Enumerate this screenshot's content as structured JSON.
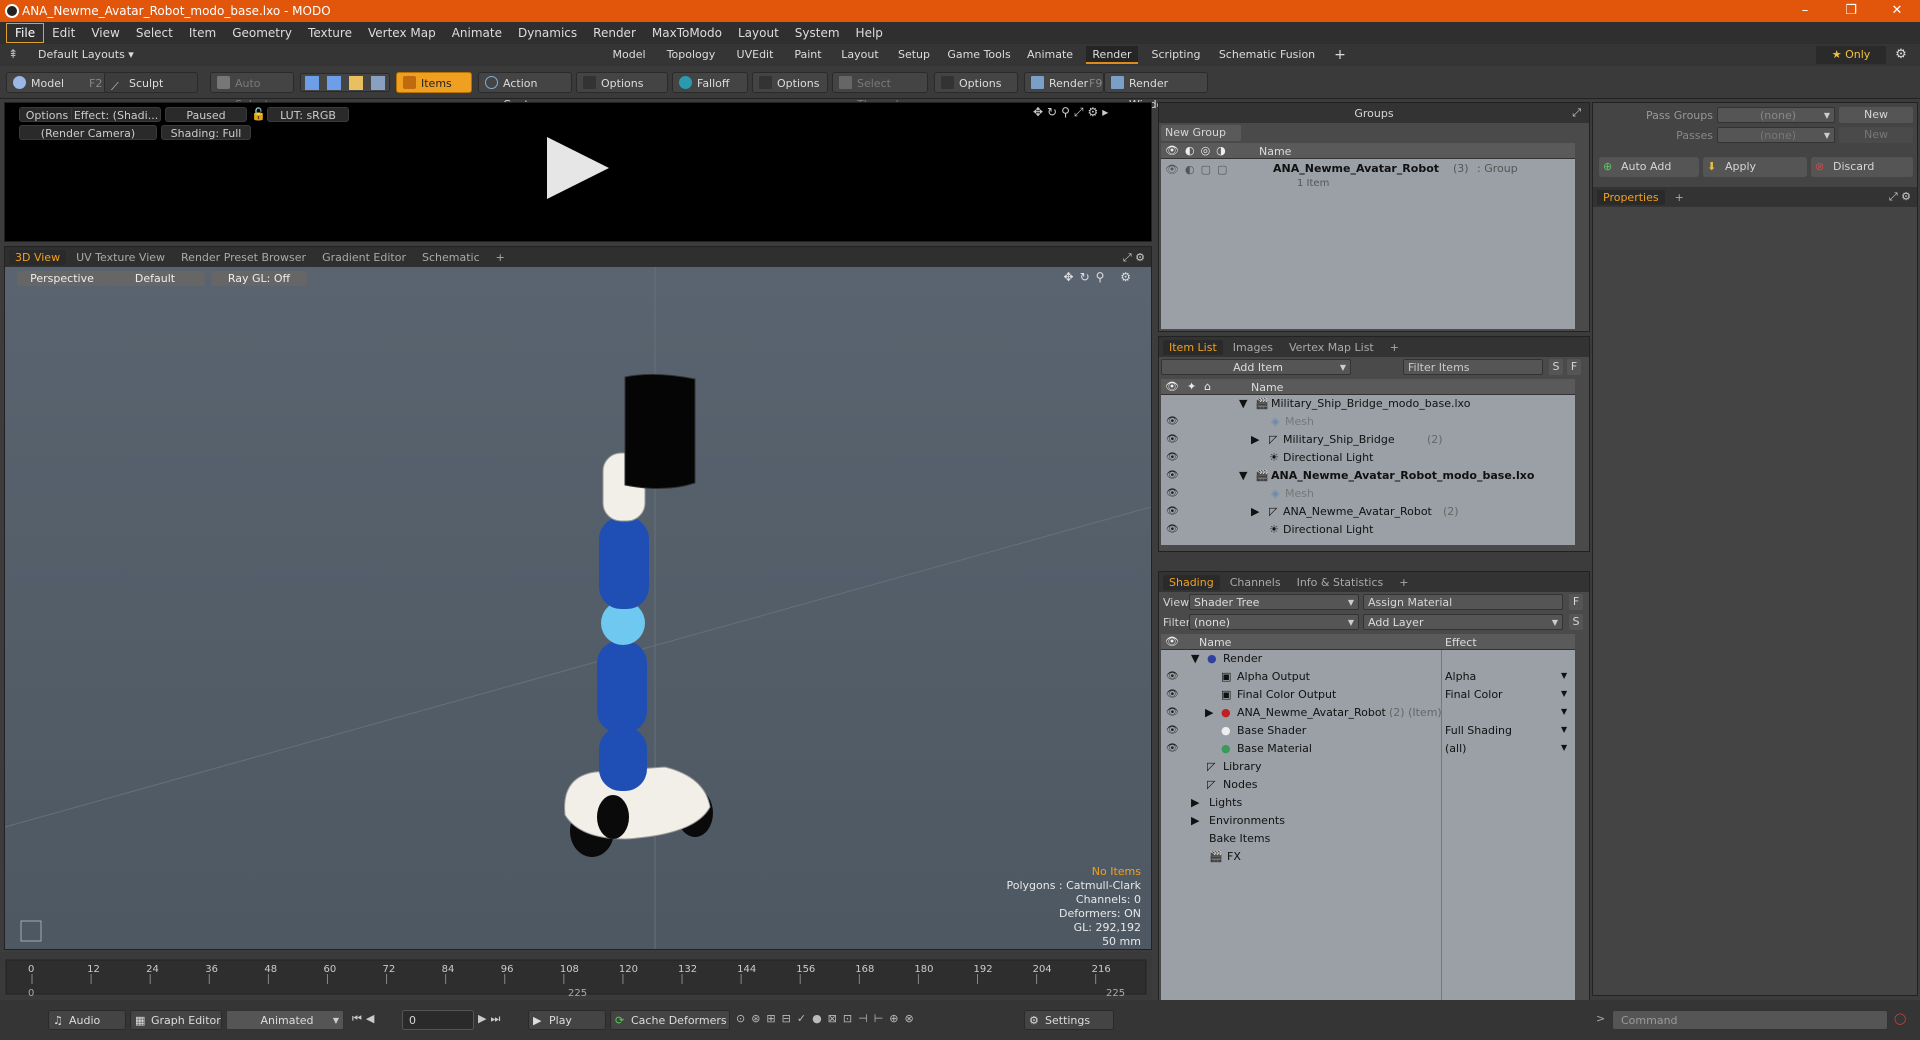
{
  "window": {
    "title": "ANA_Newme_Avatar_Robot_modo_base.lxo - MODO",
    "minimize": "–",
    "maximize": "❐",
    "close": "✕"
  },
  "menu": [
    "File",
    "Edit",
    "View",
    "Select",
    "Item",
    "Geometry",
    "Texture",
    "Vertex Map",
    "Animate",
    "Dynamics",
    "Render",
    "MaxToModo",
    "Layout",
    "System",
    "Help"
  ],
  "layout": {
    "selector": "Default Layouts ▾",
    "tabs": [
      "Model",
      "Topology",
      "UVEdit",
      "Paint",
      "Layout",
      "Setup",
      "Game Tools",
      "Animate",
      "Render",
      "Scripting",
      "Schematic Fusion"
    ],
    "active_tab": "Render",
    "add": "+",
    "only": "★  Only"
  },
  "toolbar": {
    "model": "Model",
    "model_key": "F2",
    "sculpt": "Sculpt",
    "auto_select": "Auto Select",
    "items": "Items",
    "action_center": "Action Center",
    "options1": "Options",
    "falloff": "Falloff",
    "options2": "Options",
    "select_through": "Select Through",
    "options3": "Options",
    "render": "Render",
    "render_key": "F9",
    "render_window": "Render Window"
  },
  "preview": {
    "options": "Options",
    "effect": "Effect: (Shadi...",
    "paused": "Paused",
    "lut": "LUT: sRGB",
    "camera": "(Render Camera)",
    "shading": "Shading: Full"
  },
  "viewport": {
    "tabs": [
      "3D View",
      "UV Texture View",
      "Render Preset Browser",
      "Gradient Editor",
      "Schematic"
    ],
    "add": "+",
    "perspective": "Perspective",
    "default": "Default",
    "raygl": "Ray GL: Off",
    "stats": {
      "no_items": "No Items",
      "polygons": "Polygons : Catmull-Clark",
      "channels": "Channels: 0",
      "deformers": "Deformers: ON",
      "gl": "GL: 292,192",
      "mm": "50 mm"
    }
  },
  "groups": {
    "title": "Groups",
    "new_group": "New Group",
    "col_name": "Name",
    "item_name": "ANA_Newme_Avatar_Robot",
    "item_count": "(3)",
    "item_type": ": Group",
    "item_sub": "1 Item"
  },
  "itemlist": {
    "tabs": [
      "Item List",
      "Images",
      "Vertex Map List"
    ],
    "add": "+",
    "add_item": "Add Item",
    "filter": "Filter Items",
    "s": "S",
    "f": "F",
    "col_name": "Name",
    "rows": [
      {
        "label": "Military_Ship_Bridge_modo_base.lxo",
        "extra": "",
        "bold": false
      },
      {
        "label": "Mesh",
        "extra": "",
        "bold": false
      },
      {
        "label": "Military_Ship_Bridge",
        "extra": "(2)",
        "bold": false
      },
      {
        "label": "Directional Light",
        "extra": "",
        "bold": false
      },
      {
        "label": "ANA_Newme_Avatar_Robot_modo_base.lxo",
        "extra": "",
        "bold": true
      },
      {
        "label": "Mesh",
        "extra": "",
        "bold": false
      },
      {
        "label": "ANA_Newme_Avatar_Robot",
        "extra": "(2)",
        "bold": false
      },
      {
        "label": "Directional Light",
        "extra": "",
        "bold": false
      }
    ]
  },
  "shading": {
    "tabs": [
      "Shading",
      "Channels",
      "Info & Statistics"
    ],
    "add": "+",
    "view_label": "View",
    "view_value": "Shader Tree",
    "assign": "Assign Material",
    "f": "F",
    "filter_label": "Filter",
    "filter_value": "(none)",
    "add_layer": "Add Layer",
    "s": "S",
    "col_name": "Name",
    "col_effect": "Effect",
    "rows": [
      {
        "label": "Render",
        "extra": "",
        "effect": ""
      },
      {
        "label": "Alpha Output",
        "extra": "",
        "effect": "Alpha"
      },
      {
        "label": "Final Color Output",
        "extra": "",
        "effect": "Final Color"
      },
      {
        "label": "ANA_Newme_Avatar_Robot",
        "extra": "(2) (Item)",
        "effect": ""
      },
      {
        "label": "Base Shader",
        "extra": "",
        "effect": "Full Shading"
      },
      {
        "label": "Base Material",
        "extra": "",
        "effect": "(all)"
      },
      {
        "label": "Library",
        "extra": "",
        "effect": ""
      },
      {
        "label": "Nodes",
        "extra": "",
        "effect": ""
      },
      {
        "label": "Lights",
        "extra": "",
        "effect": ""
      },
      {
        "label": "Environments",
        "extra": "",
        "effect": ""
      },
      {
        "label": "Bake Items",
        "extra": "",
        "effect": ""
      },
      {
        "label": "FX",
        "extra": "",
        "effect": ""
      }
    ]
  },
  "passes": {
    "pass_groups": "Pass Groups",
    "passes": "Passes",
    "none": "(none)",
    "new": "New",
    "auto_add": "Auto Add",
    "apply": "Apply",
    "discard": "Discard",
    "properties": "Properties",
    "add": "+"
  },
  "timeline": {
    "ticks": [
      "0",
      "12",
      "24",
      "36",
      "48",
      "60",
      "72",
      "84",
      "96",
      "108",
      "120",
      "132",
      "144",
      "156",
      "168",
      "180",
      "192",
      "204",
      "216"
    ],
    "start": "0",
    "mid": "225",
    "end": "225",
    "range_max": 225
  },
  "bottom": {
    "audio": "Audio",
    "graph_editor": "Graph Editor",
    "animated": "Animated",
    "frame": "0",
    "play": "Play",
    "cache": "Cache Deformers",
    "settings": "Settings",
    "command": "Command"
  },
  "colors": {
    "accent": "#f0a020",
    "titlebar": "#e2560b",
    "blue_body": "#1f4fb5",
    "light_blue": "#6fc8ef"
  }
}
